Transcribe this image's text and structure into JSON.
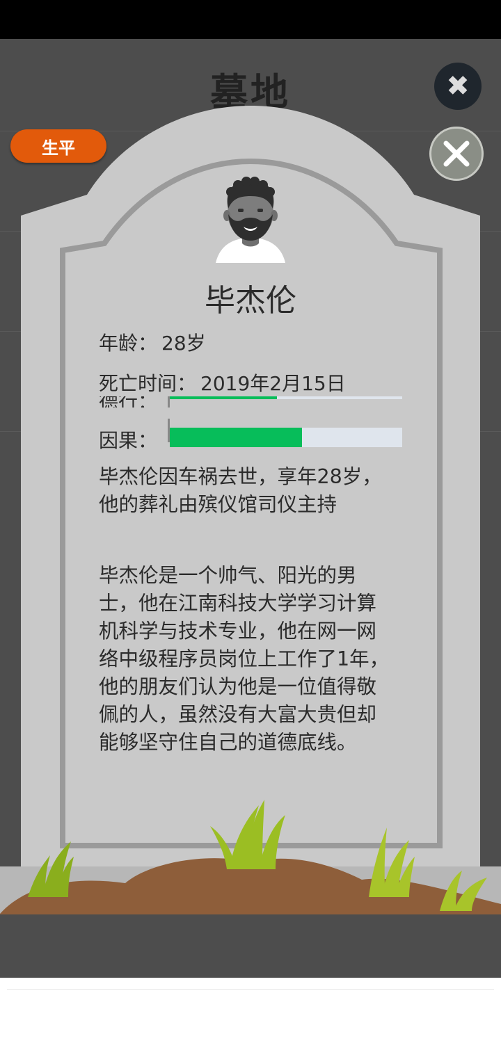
{
  "background": {
    "title": "墓地",
    "close_icon": "close-icon"
  },
  "tab": {
    "label": "生平"
  },
  "close_button": {
    "icon": "close-icon"
  },
  "profile": {
    "avatar_icon": "bearded-man-avatar",
    "name": "毕杰伦",
    "age_label": "年龄：",
    "age_value": "28岁",
    "death_label": "死亡时间：",
    "death_value": "2019年2月15日"
  },
  "bars": [
    {
      "label": "德行：",
      "fraction": 0.46
    },
    {
      "label": "因果：",
      "fraction": 0.57
    }
  ],
  "paragraphs": {
    "cause": "毕杰伦因车祸去世，享年28岁，他的葬礼由殡仪馆司仪主持",
    "bio": "毕杰伦是一个帅气、阳光的男士，他在江南科技大学学习计算机科学与技术专业，他在网一网络中级程序员岗位上工作了1年，他的朋友们认为他是一位值得敬佩的人，虽然没有大富大贵但却能够坚守住自己的道德底线。"
  },
  "colors": {
    "tab": "#e25a0b",
    "bar_fill": "#07bd5a",
    "bar_track": "#dfe5ed",
    "tombstone": "#c9c9c9"
  }
}
